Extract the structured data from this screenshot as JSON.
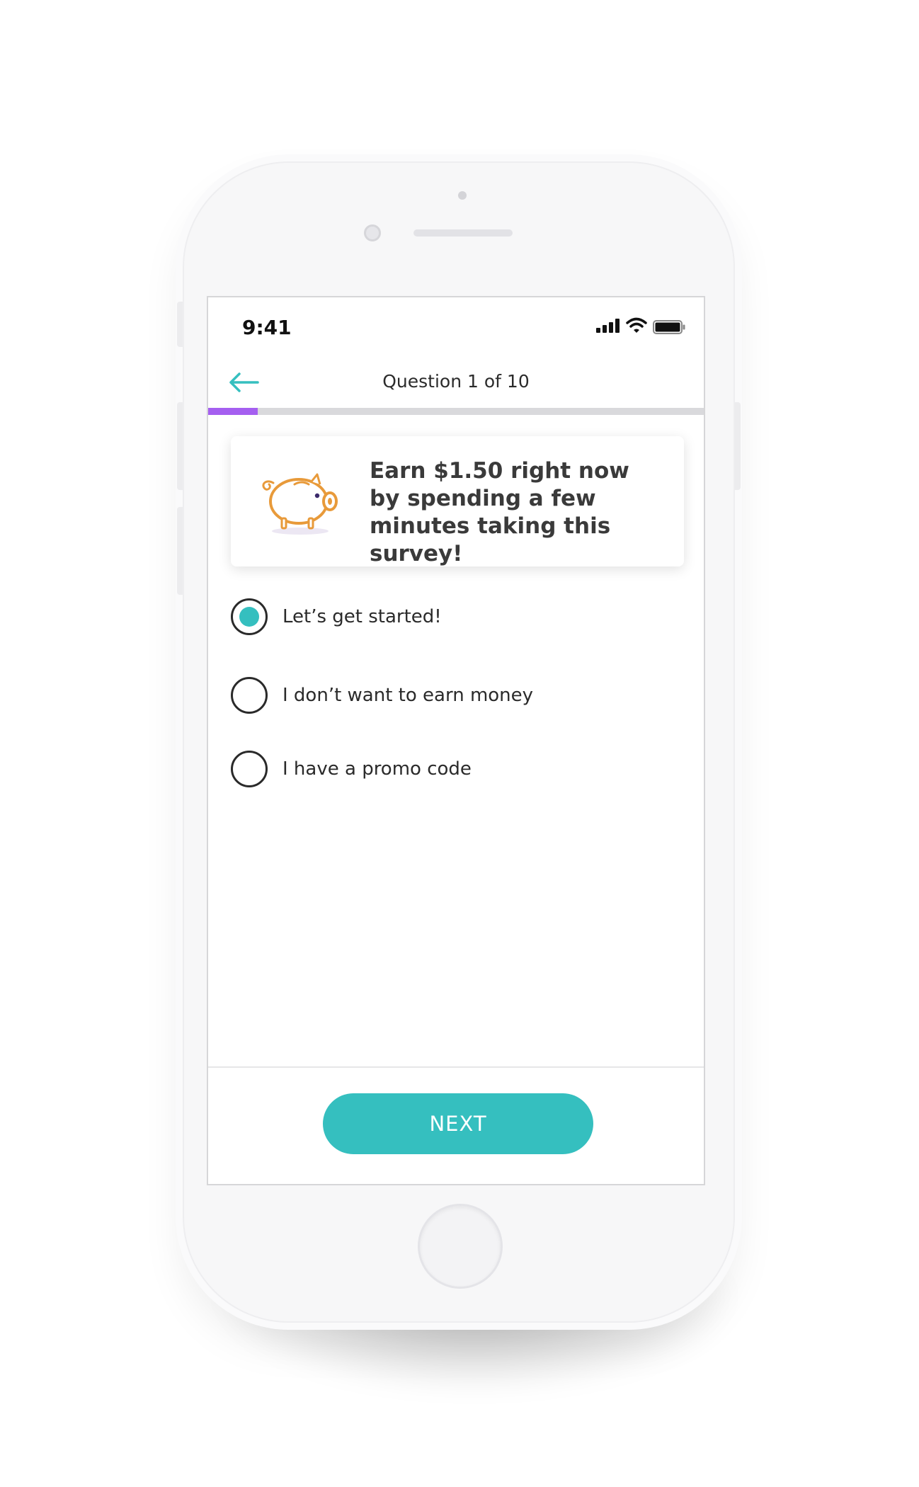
{
  "status_bar": {
    "time": "9:41"
  },
  "nav": {
    "title": "Question 1 of 10"
  },
  "progress": {
    "current": 1,
    "total": 10
  },
  "promo": {
    "text": "Earn $1.50 right now by spending a few minutes taking this survey!",
    "icon": "piggy-bank-icon"
  },
  "options": [
    {
      "label": "Let’s get started!",
      "selected": true
    },
    {
      "label": "I don’t want to earn money",
      "selected": false
    },
    {
      "label": "I have a promo code",
      "selected": false
    }
  ],
  "next_button": {
    "label": "NEXT"
  },
  "colors": {
    "accent": "#35bfbf",
    "progress": "#a55ff0",
    "piggy": "#f0a03c"
  }
}
